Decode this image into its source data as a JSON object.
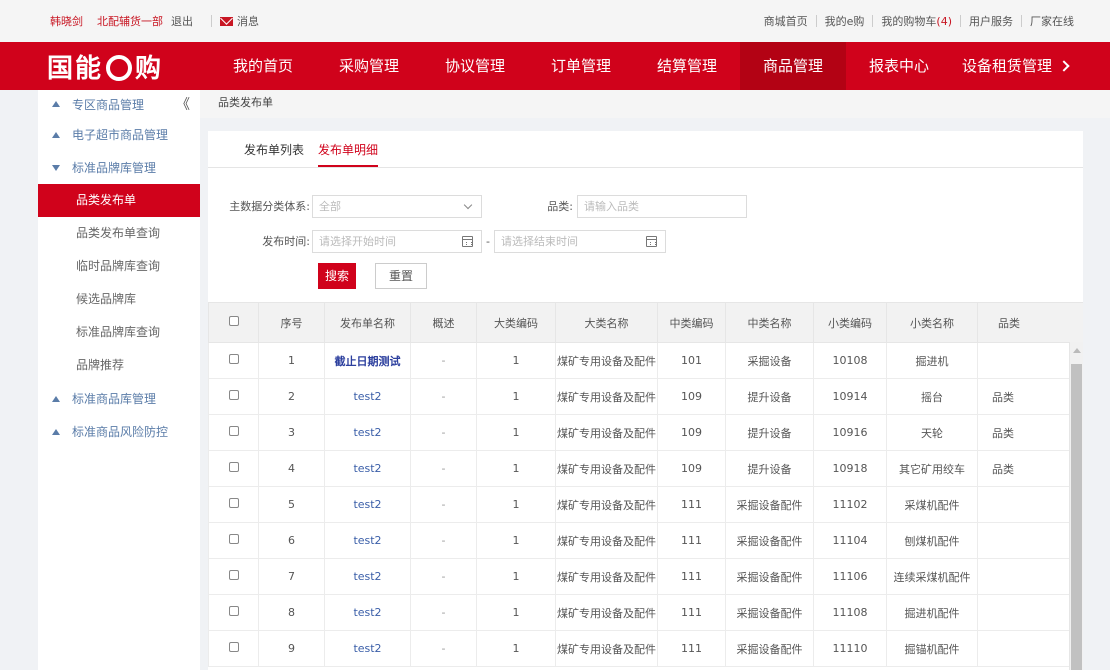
{
  "topbar": {
    "user": "韩晓剑",
    "dept": "北配辅货一部",
    "logout": "退出",
    "message": "消息",
    "links": [
      "商城首页",
      "我的e购",
      "我的购物车"
    ],
    "cart_count": "(4)",
    "links2": [
      "用户服务",
      "厂家在线"
    ]
  },
  "nav": {
    "logo_pre": "国能",
    "logo_post": "购",
    "items": [
      "我的首页",
      "采购管理",
      "协议管理",
      "订单管理",
      "结算管理",
      "商品管理",
      "报表中心",
      "设备租赁管理"
    ]
  },
  "sidebar": {
    "groups": [
      "专区商品管理",
      "电子超市商品管理",
      "标准品牌库管理",
      "标准商品库管理",
      "标准商品风险防控"
    ],
    "collapse": "《",
    "items": [
      "品类发布单",
      "品类发布单查询",
      "临时品牌库查询",
      "候选品牌库",
      "标准品牌库查询",
      "品牌推荐"
    ]
  },
  "breadcrumb": "品类发布单",
  "tabs": [
    "发布单列表",
    "发布单明细"
  ],
  "filters": {
    "classification_label": "主数据分类体系:",
    "classification_value": "全部",
    "category_label": "品类:",
    "category_placeholder": "请输入品类",
    "time_label": "发布时间:",
    "start_placeholder": "请选择开始时间",
    "end_placeholder": "请选择结束时间",
    "range_sep": "-",
    "search": "搜索",
    "reset": "重置"
  },
  "table": {
    "headers": [
      "序号",
      "发布单名称",
      "概述",
      "大类编码",
      "大类名称",
      "中类编码",
      "中类名称",
      "小类编码",
      "小类名称",
      "品类"
    ],
    "rows": [
      [
        "1",
        "截止日期测试",
        "-",
        "1",
        "煤矿专用设备及配件",
        "101",
        "采掘设备",
        "10108",
        "掘进机",
        ""
      ],
      [
        "2",
        "test2",
        "-",
        "1",
        "煤矿专用设备及配件",
        "109",
        "提升设备",
        "10914",
        "摇台",
        "品类"
      ],
      [
        "3",
        "test2",
        "-",
        "1",
        "煤矿专用设备及配件",
        "109",
        "提升设备",
        "10916",
        "天轮",
        "品类"
      ],
      [
        "4",
        "test2",
        "-",
        "1",
        "煤矿专用设备及配件",
        "109",
        "提升设备",
        "10918",
        "其它矿用绞车",
        "品类"
      ],
      [
        "5",
        "test2",
        "-",
        "1",
        "煤矿专用设备及配件",
        "111",
        "采掘设备配件",
        "11102",
        "采煤机配件",
        ""
      ],
      [
        "6",
        "test2",
        "-",
        "1",
        "煤矿专用设备及配件",
        "111",
        "采掘设备配件",
        "11104",
        "刨煤机配件",
        ""
      ],
      [
        "7",
        "test2",
        "-",
        "1",
        "煤矿专用设备及配件",
        "111",
        "采掘设备配件",
        "11106",
        "连续采煤机配件",
        ""
      ],
      [
        "8",
        "test2",
        "-",
        "1",
        "煤矿专用设备及配件",
        "111",
        "采掘设备配件",
        "11108",
        "掘进机配件",
        ""
      ],
      [
        "9",
        "test2",
        "-",
        "1",
        "煤矿专用设备及配件",
        "111",
        "采掘设备配件",
        "11110",
        "掘锚机配件",
        ""
      ]
    ]
  }
}
